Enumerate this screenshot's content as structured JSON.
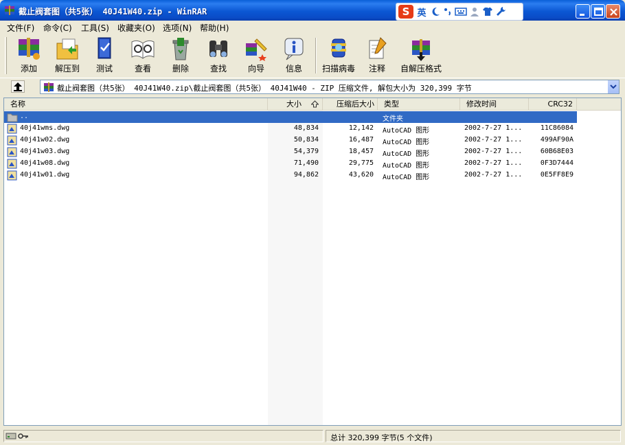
{
  "window": {
    "title": "截止阀套图（共5张） 40J41W40.zip - WinRAR",
    "app_icon": "winrar-books-icon"
  },
  "ime": {
    "logo": "S",
    "mode": "英",
    "icons": [
      "moon-icon",
      "punctuation-icon",
      "keyboard-icon",
      "user-icon",
      "shirt-icon",
      "wrench-icon"
    ]
  },
  "menu": [
    {
      "label": "文件(F)"
    },
    {
      "label": "命令(C)"
    },
    {
      "label": "工具(S)"
    },
    {
      "label": "收藏夹(O)"
    },
    {
      "label": "选项(N)"
    },
    {
      "label": "帮助(H)"
    }
  ],
  "toolbar": [
    {
      "label": "添加",
      "icon": "add-icon"
    },
    {
      "label": "解压到",
      "icon": "extract-to-icon"
    },
    {
      "label": "测试",
      "icon": "test-icon"
    },
    {
      "label": "查看",
      "icon": "view-icon"
    },
    {
      "label": "删除",
      "icon": "delete-icon"
    },
    {
      "label": "查找",
      "icon": "find-icon"
    },
    {
      "label": "向导",
      "icon": "wizard-icon"
    },
    {
      "label": "信息",
      "icon": "info-icon"
    },
    {
      "label": "扫描病毒",
      "icon": "virus-scan-icon"
    },
    {
      "label": "注释",
      "icon": "comment-icon"
    },
    {
      "label": "自解压格式",
      "icon": "sfx-icon"
    }
  ],
  "address": {
    "path": "截止阀套图（共5张） 40J41W40.zip\\截止阀套图（共5张） 40J41W40 - ZIP 压缩文件, 解包大小为 320,399 字节"
  },
  "columns": {
    "name": "名称",
    "size": "大小",
    "packed": "压缩后大小",
    "type": "类型",
    "modified": "修改时间",
    "crc": "CRC32"
  },
  "parent_row": {
    "name": "..",
    "type": "文件夹"
  },
  "files": [
    {
      "name": "40j41wms.dwg",
      "size": "48,834",
      "packed": "12,142",
      "type": "AutoCAD 图形",
      "modified": "2002-7-27 1...",
      "crc": "11C86084"
    },
    {
      "name": "40j41w02.dwg",
      "size": "50,834",
      "packed": "16,487",
      "type": "AutoCAD 图形",
      "modified": "2002-7-27 1...",
      "crc": "499AF90A"
    },
    {
      "name": "40j41w03.dwg",
      "size": "54,379",
      "packed": "18,457",
      "type": "AutoCAD 图形",
      "modified": "2002-7-27 1...",
      "crc": "60B68E03"
    },
    {
      "name": "40j41w08.dwg",
      "size": "71,490",
      "packed": "29,775",
      "type": "AutoCAD 图形",
      "modified": "2002-7-27 1...",
      "crc": "0F3D7444"
    },
    {
      "name": "40j41w01.dwg",
      "size": "94,862",
      "packed": "43,620",
      "type": "AutoCAD 图形",
      "modified": "2002-7-27 1...",
      "crc": "0E5FF8E9"
    }
  ],
  "status": {
    "left": "",
    "right": "总计 320,399 字节(5 个文件)"
  }
}
